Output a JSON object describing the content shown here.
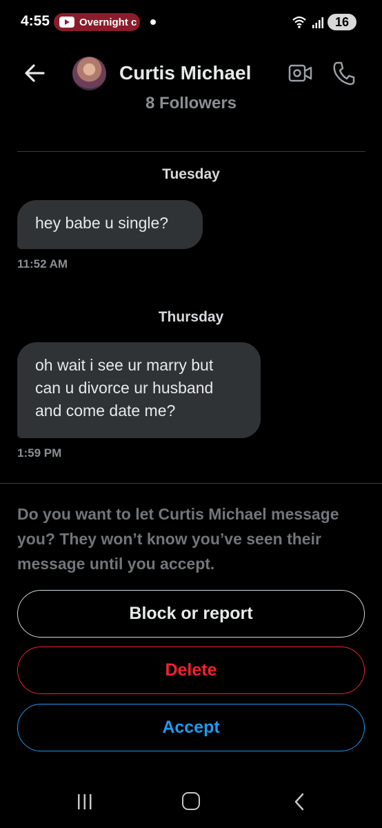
{
  "status_bar": {
    "time": "4:55",
    "notification_label": "Overnight c",
    "battery_level": "16"
  },
  "header": {
    "contact_name": "Curtis Michael",
    "followers": "8 Followers"
  },
  "conversation": [
    {
      "day": "Tuesday",
      "message": "hey babe u single?",
      "time": "11:52 AM"
    },
    {
      "day": "Thursday",
      "message": "oh wait i see ur marry but can u divorce ur husband and come date me?",
      "time": "1:59 PM"
    }
  ],
  "request": {
    "prompt": "Do you want to let Curtis Michael message you? They won’t know you’ve seen their message until you accept.",
    "block_label": "Block or report",
    "delete_label": "Delete",
    "accept_label": "Accept"
  },
  "colors": {
    "background": "#000000",
    "bubble": "#2f3336",
    "delete": "#f4212e",
    "accept": "#1d9bf0",
    "notification_badge": "#8a1c2b"
  },
  "icons": [
    "back-arrow-icon",
    "video-call-icon",
    "phone-icon",
    "wifi-icon",
    "signal-icon",
    "youtube-icon",
    "recent-apps-icon",
    "home-icon",
    "nav-back-icon"
  ]
}
